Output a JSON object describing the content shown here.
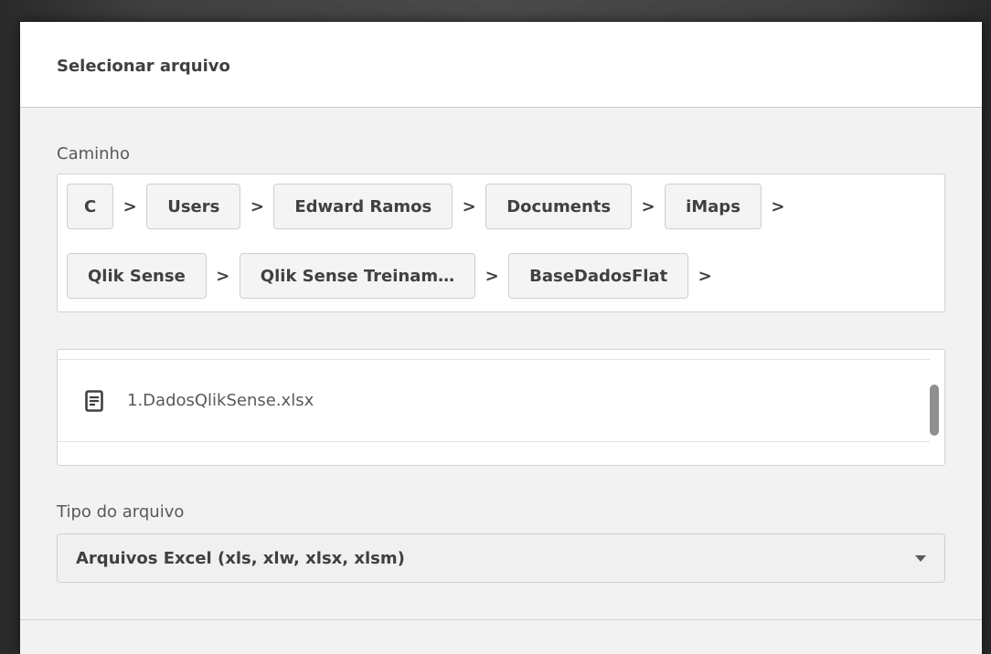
{
  "dialog": {
    "title": "Selecionar arquivo"
  },
  "path": {
    "label": "Caminho",
    "separator": ">",
    "row1": [
      "C",
      "Users",
      "Edward Ramos",
      "Documents",
      "iMaps"
    ],
    "row2": [
      "Qlik Sense",
      "Qlik Sense Treinam…",
      "BaseDadosFlat"
    ]
  },
  "files": {
    "items": [
      {
        "name": "1.DadosQlikSense.xlsx",
        "icon": "file-icon"
      }
    ]
  },
  "file_type": {
    "label": "Tipo do arquivo",
    "selected": "Arquivos Excel (xls, xlw, xlsx, xlsm)"
  },
  "colors": {
    "text_dark": "#404040",
    "text_muted": "#595959",
    "panel_bg": "#f2f2f2",
    "border": "#d2d2d2"
  }
}
